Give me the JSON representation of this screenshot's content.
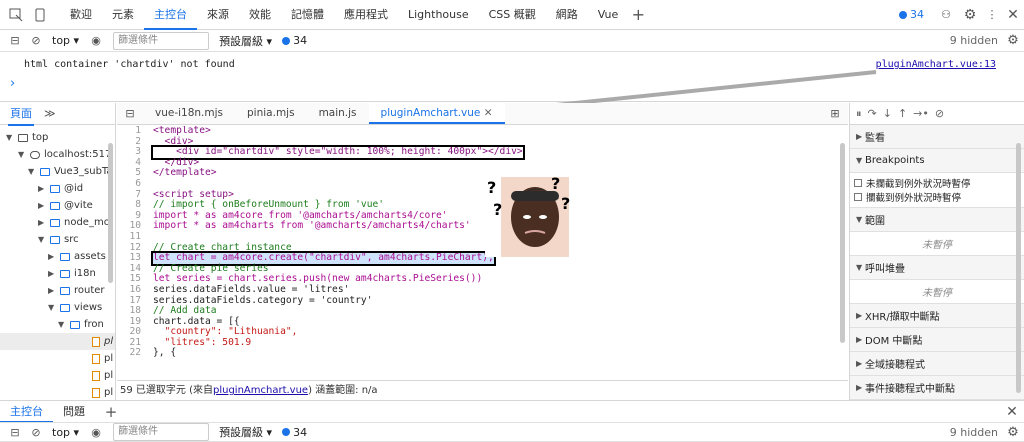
{
  "top_tabs": [
    "歡迎",
    "元素",
    "主控台",
    "來源",
    "效能",
    "記憶體",
    "應用程式",
    "Lighthouse",
    "CSS 概觀",
    "網路",
    "Vue"
  ],
  "top_active": "主控台",
  "top_count": "34",
  "console": {
    "context": "top",
    "filter_placeholder": "篩選條件",
    "levels": "預設層級",
    "count": "34",
    "hidden": "9 hidden",
    "message": "html container 'chartdiv' not found",
    "source_link": "pluginAmchart.vue:13",
    "prompt": "›"
  },
  "sidebar": {
    "tab_page": "頁面",
    "more": "≫",
    "items": [
      {
        "label": "top",
        "kind": "frame"
      },
      {
        "label": "localhost:517",
        "kind": "cloud"
      },
      {
        "label": "Vue3_subTa",
        "kind": "folder"
      },
      {
        "label": "@id",
        "kind": "folder"
      },
      {
        "label": "@vite",
        "kind": "folder"
      },
      {
        "label": "node_mo",
        "kind": "folder"
      },
      {
        "label": "src",
        "kind": "folder"
      },
      {
        "label": "assets",
        "kind": "folder"
      },
      {
        "label": "i18n",
        "kind": "folder"
      },
      {
        "label": "router",
        "kind": "folder"
      },
      {
        "label": "views",
        "kind": "folder"
      },
      {
        "label": "fron",
        "kind": "folder"
      },
      {
        "label": "pl",
        "kind": "file"
      },
      {
        "label": "pl",
        "kind": "file"
      },
      {
        "label": "pl",
        "kind": "file"
      },
      {
        "label": "pl",
        "kind": "file"
      }
    ]
  },
  "editor": {
    "tabs": [
      "vue-i18n.mjs",
      "pinia.mjs",
      "main.js",
      "pluginAmchart.vue"
    ],
    "active_tab": "pluginAmchart.vue",
    "lines": [
      "<template>",
      "  <div>",
      "    <div id=\"chartdiv\" style=\"width: 100%; height: 400px\"></div>",
      "  </div>",
      "</template>",
      "",
      "<script setup>",
      "// import { onBeforeUnmount } from 'vue'",
      "import * as am4core from '@amcharts/amcharts4/core'",
      "import * as am4charts from '@amcharts/amcharts4/charts'",
      "",
      "// Create chart instance",
      "let chart = am4core.create(\"chartdiv\", am4charts.PieChart);",
      "// Create pie series",
      "let series = chart.series.push(new am4charts.PieSeries())",
      "series.dataFields.value = 'litres'",
      "series.dataFields.category = 'country'",
      "// Add data",
      "chart.data = [{",
      "  \"country\": \"Lithuania\",",
      "  \"litres\": 501.9",
      "}, {"
    ],
    "status_prefix": "59 已選取字元 (來自",
    "status_link": "pluginAmchart.vue",
    "status_suffix": ") 涵蓋範圍: n/a"
  },
  "right": {
    "watch": "監看",
    "breakpoints": "Breakpoints",
    "bp_opt1": "未攔截到例外狀況時暫停",
    "bp_opt2": "攔截到例外狀況時暫停",
    "scope": "範圍",
    "not_paused1": "未暫停",
    "callstack": "呼叫堆疊",
    "not_paused2": "未暫停",
    "xhr": "XHR/擷取中斷點",
    "dom": "DOM 中斷點",
    "global": "全域接聽程式",
    "event": "事件接聽程式中斷點"
  },
  "drawer": {
    "tabs": [
      "主控台",
      "問題"
    ],
    "context": "top",
    "filter_placeholder": "篩選條件",
    "levels": "預設層級",
    "count": "34",
    "hidden": "9 hidden"
  }
}
